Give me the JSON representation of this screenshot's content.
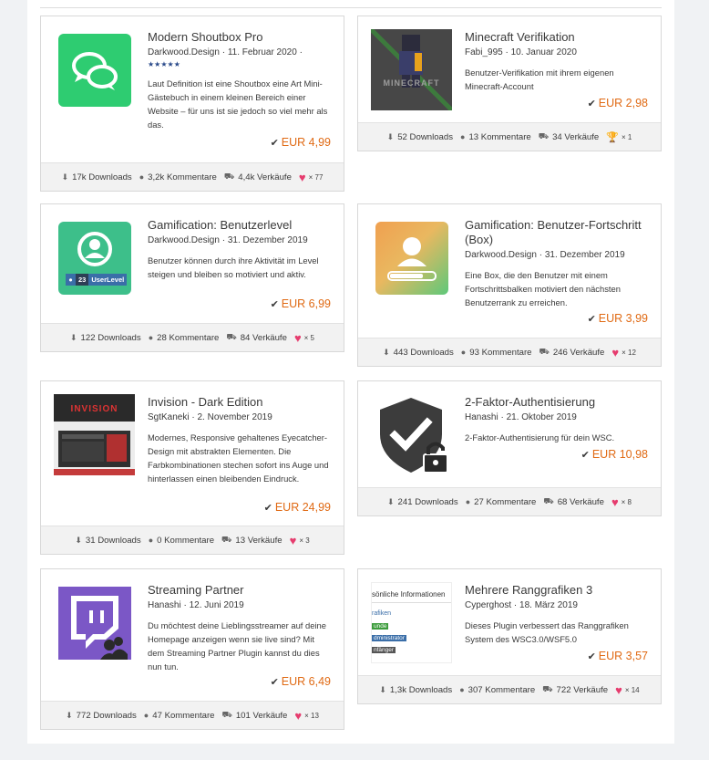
{
  "cards": [
    {
      "title": "Modern Shoutbox Pro",
      "author": "Darkwood.Design",
      "date": "11. Februar 2020",
      "stars": "★★★★★",
      "desc": "Laut Definition ist eine Shoutbox eine Art Mini-Gästebuch in einem kleinen Bereich einer Website – für uns ist sie jedoch so viel mehr als das.",
      "price": "EUR 4,99",
      "downloads": "17k Downloads",
      "comments": "3,2k Kommentare",
      "sales": "4,4k Verkäufe",
      "likes": "× 77"
    },
    {
      "title": "Minecraft Verifikation",
      "author": "Fabi_995",
      "date": "10. Januar 2020",
      "desc": "Benutzer-Verifikation mit ihrem eigenen Minecraft-Account",
      "price": "EUR 2,98",
      "downloads": "52 Downloads",
      "comments": "13 Kommentare",
      "sales": "34 Verkäufe",
      "likes": "× 1",
      "thumb_text": "MINECRAFT"
    },
    {
      "title": "Gamification: Benutzerlevel",
      "author": "Darkwood.Design",
      "date": "31. Dezember 2019",
      "desc": "Benutzer können durch ihre Aktivität im Level steigen und bleiben so motiviert und aktiv.",
      "price": "EUR 6,99",
      "downloads": "122 Downloads",
      "comments": "28 Kommentare",
      "sales": "84 Verkäufe",
      "likes": "× 5",
      "badge_num": "23",
      "badge_label": "UserLevel"
    },
    {
      "title": "Gamification: Benutzer-Fortschritt (Box)",
      "author": "Darkwood.Design",
      "date": "31. Dezember 2019",
      "desc": "Eine Box, die den Benutzer mit einem Fortschrittsbalken motiviert den nächsten Benutzerrank zu erreichen.",
      "price": "EUR 3,99",
      "downloads": "443 Downloads",
      "comments": "93 Kommentare",
      "sales": "246 Verkäufe",
      "likes": "× 12"
    },
    {
      "title": "Invision - Dark Edition",
      "author": "SgtKaneki",
      "date": "2. November 2019",
      "desc": "Modernes, Responsive gehaltenes Eyecatcher-Design mit abstrakten Elementen. Die Farbkombinationen stechen sofort ins Auge und hinterlassen einen bleibenden Eindruck.",
      "price": "EUR 24,99",
      "downloads": "31 Downloads",
      "comments": "0 Kommentare",
      "sales": "13 Verkäufe",
      "likes": "× 3",
      "thumb_text": "INVISION"
    },
    {
      "title": "2-Faktor-Authentisierung",
      "author": "Hanashi",
      "date": "21. Oktober 2019",
      "desc": "2-Faktor-Authentisierung für dein WSC.",
      "price": "EUR 10,98",
      "downloads": "241 Downloads",
      "comments": "27 Kommentare",
      "sales": "68 Verkäufe",
      "likes": "× 8"
    },
    {
      "title": "Streaming Partner",
      "author": "Hanashi",
      "date": "12. Juni 2019",
      "desc": "Du möchtest deine Lieblingsstreamer auf deine Homepage anzeigen wenn sie live sind? Mit dem Streaming Partner Plugin kannst du dies nun tun.",
      "price": "EUR 6,49",
      "downloads": "772 Downloads",
      "comments": "47 Kommentare",
      "sales": "101 Verkäufe",
      "likes": "× 13"
    },
    {
      "title": "Mehrere Ranggrafiken 3",
      "author": "Cyperghost",
      "date": "18. März 2019",
      "desc": "Dieses Plugin verbessert das Ranggrafiken System des WSC3.0/WSF5.0",
      "price": "EUR 3,57",
      "downloads": "1,3k Downloads",
      "comments": "307 Kommentare",
      "sales": "722 Verkäufe",
      "likes": "× 14",
      "thumb_lines": [
        "sönliche Informationen",
        "rafiken",
        "unde",
        "dministrator",
        "nfänger"
      ]
    }
  ],
  "colors": {
    "price": "#e06a14",
    "heart": "#e63c6e",
    "shoutbox": "#2ecc71",
    "level": "#3dbf8a",
    "twitch": "#7b57c6"
  },
  "icons": [
    "download-icon",
    "comment-icon",
    "cart-icon",
    "heart-icon",
    "trophy-icon",
    "check-icon"
  ]
}
